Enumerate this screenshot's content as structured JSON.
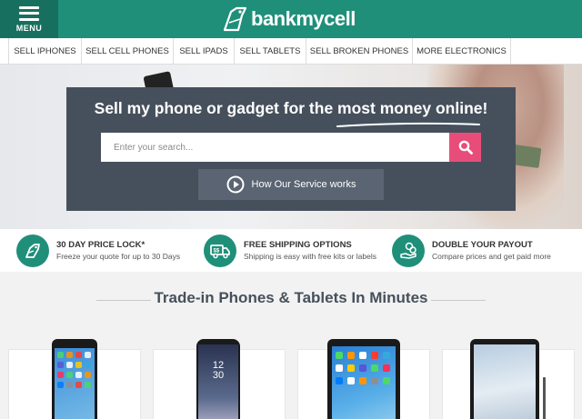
{
  "header": {
    "menu_label": "MENU",
    "logo_text": "bankmycell",
    "logo_icon": "tag-phone-logo-icon"
  },
  "nav": {
    "items": [
      {
        "label": "SELL IPHONES"
      },
      {
        "label": "SELL CELL PHONES"
      },
      {
        "label": "SELL IPADS"
      },
      {
        "label": "SELL TABLETS"
      },
      {
        "label": "SELL BROKEN PHONES"
      },
      {
        "label": "MORE ELECTRONICS"
      }
    ]
  },
  "hero": {
    "title": "Sell my phone or gadget for the most money online!",
    "search_placeholder": "Enter your search...",
    "search_icon": "search-icon",
    "how_button_label": "How Our Service works",
    "how_icon": "play-circle-icon"
  },
  "features": [
    {
      "title": "30 DAY PRICE LOCK*",
      "desc": "Freeze your quote for up to 30 Days",
      "icon": "price-tag-icon"
    },
    {
      "title": "FREE SHIPPING OPTIONS",
      "desc": "Shipping is easy with free kits or labels",
      "icon": "truck-icon"
    },
    {
      "title": "DOUBLE YOUR PAYOUT",
      "desc": "Compare prices and get paid more",
      "icon": "coins-hand-icon"
    }
  ],
  "section": {
    "title": "Trade-in Phones & Tablets In Minutes"
  },
  "cards": [
    {
      "device": "iphone-image"
    },
    {
      "device": "galaxy-phone-image",
      "screen_time": "12",
      "screen_min": "30"
    },
    {
      "device": "ipad-image"
    },
    {
      "device": "galaxy-tab-image"
    }
  ],
  "colors": {
    "brand_green": "#1f8f7a",
    "panel": "#46505c",
    "search_button": "#e84d7a"
  }
}
